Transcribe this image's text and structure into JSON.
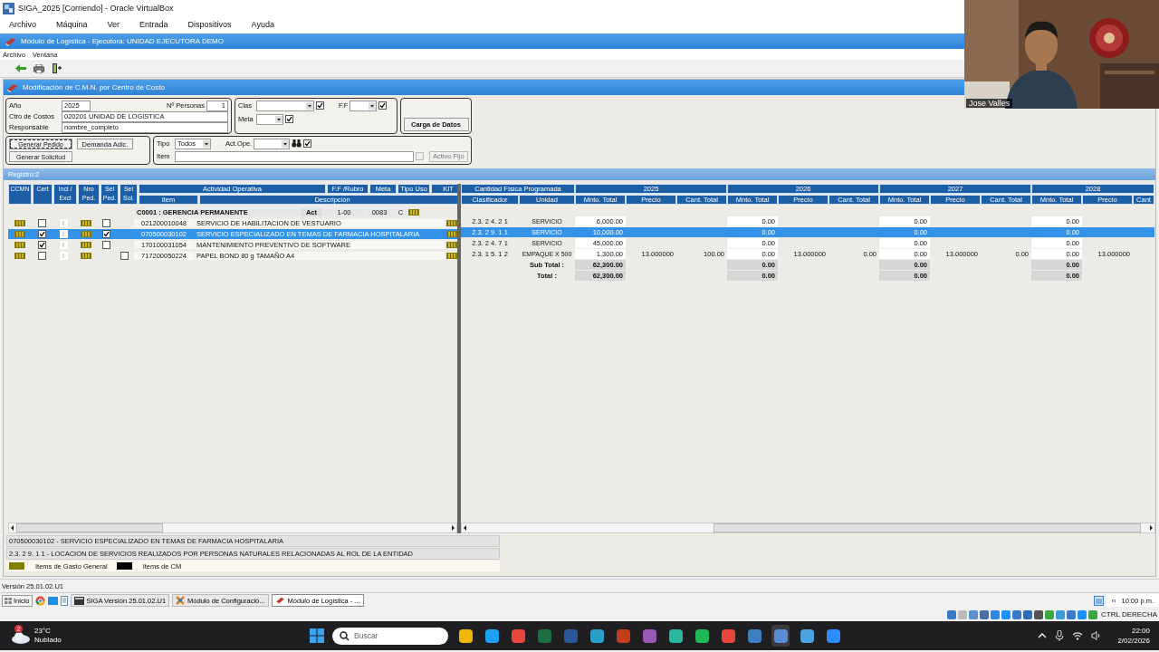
{
  "vbox": {
    "title": "SIGA_2025 [Corriendo] - Oracle VirtualBox",
    "menu": [
      "Archivo",
      "Máquina",
      "Ver",
      "Entrada",
      "Dispositivos",
      "Ayuda"
    ]
  },
  "app": {
    "title": "Módulo de Logística - Ejecutora: UNIDAD EJECUTORA DEMO",
    "menu": [
      "Archivo",
      "Ventana"
    ]
  },
  "webcam": {
    "name": "Jose Valles"
  },
  "window": {
    "title": "Modificación de C.M.N. por Centro de Costo"
  },
  "form": {
    "anio": {
      "label": "Año",
      "value": "2025"
    },
    "personas": {
      "label": "Nº Personas",
      "value": "1"
    },
    "centro": {
      "label": "Ctro de Costos",
      "value": "020201  UNIDAD DE LOGISTICA"
    },
    "responsable": {
      "label": "Responsable",
      "value": "nombre_completo"
    },
    "clas": {
      "label": "Clas",
      "checked": true
    },
    "ff": {
      "label": "F.F",
      "checked": true
    },
    "meta": {
      "label": "Meta",
      "checked": true
    },
    "carga": "Carga de Datos",
    "generar_pedido": "Generar Pedido",
    "demanda": "Demanda Adic.",
    "generar_solicitud": "Generar Solicitud",
    "tipo": {
      "label": "Tipo",
      "value": "Todos"
    },
    "act_ope": {
      "label": "Act.Ope.",
      "checked": true
    },
    "item": {
      "label": "Item"
    },
    "activo_fijo": {
      "label": "Activo Fijo",
      "checked": false,
      "disabled": true
    }
  },
  "records": "Registro:2",
  "left_header": {
    "fixed": [
      "CCMN",
      "Cert",
      "Incl / Excl",
      "Nro Ped.",
      "Sel Ped.",
      "Sel Sol."
    ],
    "top": [
      "Actividad Operativa",
      "F.F /Rubro",
      "Meta",
      "Tipo Uso",
      "KIT"
    ],
    "bottom": [
      "Item",
      "Descripción"
    ]
  },
  "group": {
    "title": "C0001 : GERENCIA PERMANENTE",
    "act": "Act",
    "code": "1-00",
    "meta": "0083",
    "tipo": "C"
  },
  "right_header": {
    "group": "Cantidad Física Programada",
    "columns": [
      "Clasificador",
      "Unidad"
    ],
    "years": [
      {
        "year": "2025",
        "columns": [
          "Mnto. Total",
          "Precio",
          "Cant. Total"
        ]
      },
      {
        "year": "2026",
        "columns": [
          "Mnto. Total",
          "Precio",
          "Cant. Total"
        ]
      },
      {
        "year": "2027",
        "columns": [
          "Mnto. Total",
          "Precio",
          "Cant. Total"
        ]
      },
      {
        "year": "2028",
        "columns": [
          "Mnto. Total",
          "Precio",
          "Cant"
        ]
      }
    ]
  },
  "rows": [
    {
      "selected": false,
      "cert": false,
      "incl": "I",
      "sel_ped": false,
      "item": "021200010048",
      "desc": "SERVICIO DE HABILITACION DE VESTUARIO",
      "clasificador": "2.3. 2 4. 2 1",
      "unidad": "SERVICIO",
      "years": [
        {
          "mnto": "6,000.00"
        },
        {
          "mnto": "0.00"
        },
        {
          "mnto": "0.00"
        },
        {
          "mnto": "0.00"
        }
      ]
    },
    {
      "selected": true,
      "cert": true,
      "incl": "I",
      "sel_ped": true,
      "item": "070500030102",
      "desc": "SERVICIO ESPECIALIZADO EN TEMAS DE FARMACIA HOSPITALARIA",
      "clasificador": "2.3. 2 9. 1 1",
      "unidad": "SERVICIO",
      "years": [
        {
          "mnto": "10,000.00"
        },
        {
          "mnto": "0.00"
        },
        {
          "mnto": "0.00"
        },
        {
          "mnto": "0.00"
        }
      ]
    },
    {
      "selected": false,
      "cert": true,
      "incl": "I",
      "sel_ped": false,
      "item": "170100031054",
      "desc": "MANTENIMIENTO PREVENTIVO DE SOFTWARE",
      "clasificador": "2.3. 2 4. 7 1",
      "unidad": "SERVICIO",
      "years": [
        {
          "mnto": "45,000.00"
        },
        {
          "mnto": "0.00"
        },
        {
          "mnto": "0.00"
        },
        {
          "mnto": "0.00"
        }
      ]
    },
    {
      "selected": false,
      "cert": false,
      "incl": "I",
      "sel_sol": false,
      "item": "717200050224",
      "desc": "PAPEL BOND 80 g TAMAÑO  A4",
      "clasificador": "2.3. 1 5. 1 2",
      "unidad": "EMPAQUE X 500",
      "years": [
        {
          "mnto": "1,300.00",
          "precio": "13.000000",
          "cant": "100.00"
        },
        {
          "mnto": "0.00",
          "precio": "13.000000",
          "cant": "0.00"
        },
        {
          "mnto": "0.00",
          "precio": "13.000000",
          "cant": "0.00"
        },
        {
          "mnto": "0.00",
          "precio": "13.000000"
        }
      ]
    }
  ],
  "totals": [
    {
      "label": "Sub Total :",
      "values": [
        "62,300.00",
        "0.00",
        "0.00",
        "0.00"
      ]
    },
    {
      "label": "Total :",
      "values": [
        "62,300.00",
        "0.00",
        "0.00",
        "0.00"
      ]
    }
  ],
  "info": {
    "lines": [
      "070500030102 - SERVICIO ESPECIALIZADO EN TEMAS DE FARMACIA HOSPITALARIA",
      "2.3. 2  9. 1  1 - LOCACION DE SERVICIOS REALIZADOS POR PERSONAS NATURALES RELACIONADAS AL ROL DE LA ENTIDAD"
    ],
    "legend": [
      {
        "label": "Items de Gasto General",
        "color": "#808000"
      },
      {
        "label": "Items de CM",
        "color": "#000000"
      }
    ]
  },
  "status": "Versión 25.01.02.U1",
  "guest_taskbar": {
    "start": "Inicio",
    "windows": [
      {
        "label": "SIGA Versión 25.01.02.U1",
        "selected": false
      },
      {
        "label": "Módulo de Configuració...",
        "selected": false
      },
      {
        "label": "Módulo de Logística - ...",
        "selected": true
      }
    ],
    "clock": "10:00 p.m.",
    "collapse": "‹‹"
  },
  "vbox_status": "CTRL DERECHA",
  "taskbar": {
    "weather": {
      "badge": "2",
      "temp": "23°C",
      "condition": "Nublado"
    },
    "search": {
      "placeholder": "Buscar"
    },
    "time": "22:00",
    "date": "2/02/2026"
  }
}
